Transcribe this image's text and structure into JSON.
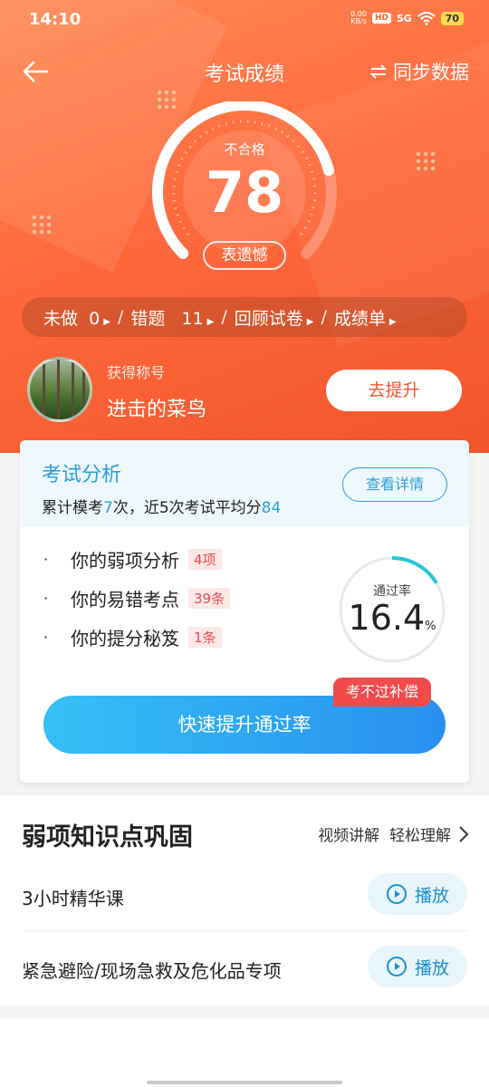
{
  "status": {
    "time": "14:10",
    "net_speed": "0.00",
    "net_unit": "KB/s",
    "hd": "HD",
    "signal": "5G",
    "battery": "70"
  },
  "header": {
    "title": "考试成绩",
    "sync_label": "同步数据"
  },
  "score": {
    "status": "不合格",
    "value": "78",
    "pill": "表遗憾",
    "fraction": 0.78
  },
  "links": [
    {
      "label": "未做",
      "count": "0"
    },
    {
      "label": "错题",
      "count": "11"
    },
    {
      "label": "回顾试卷"
    },
    {
      "label": "成绩单"
    }
  ],
  "profile": {
    "label": "获得称号",
    "honor": "进击的菜鸟",
    "button": "去提升"
  },
  "analysis": {
    "title": "考试分析",
    "sub_prefix": "累计模考",
    "mock_count": "7",
    "sub_middle": "次，近5次考试平均分",
    "avg_score": "84",
    "detail_button": "查看详情",
    "items": [
      {
        "label": "你的弱项分析",
        "tag": "4项"
      },
      {
        "label": "你的易错考点",
        "tag": "39条"
      },
      {
        "label": "你的提分秘笈",
        "tag": "1条"
      }
    ],
    "pass_rate_label": "通过率",
    "pass_rate_value": "16.4",
    "pass_rate_unit": "%",
    "badge": "考不过补偿",
    "main_button": "快速提升通过率"
  },
  "weak": {
    "title": "弱项知识点巩固",
    "link": "视频讲解  轻松理解",
    "courses": [
      {
        "title": "3小时精华课",
        "button": "播放"
      },
      {
        "title": "紧急避险/现场急救及危化品专项",
        "button": "播放"
      }
    ]
  },
  "colors": {
    "hero": "#ff6a3d",
    "accent_blue": "#2a9fd8",
    "tag_red": "#e84c4c"
  }
}
